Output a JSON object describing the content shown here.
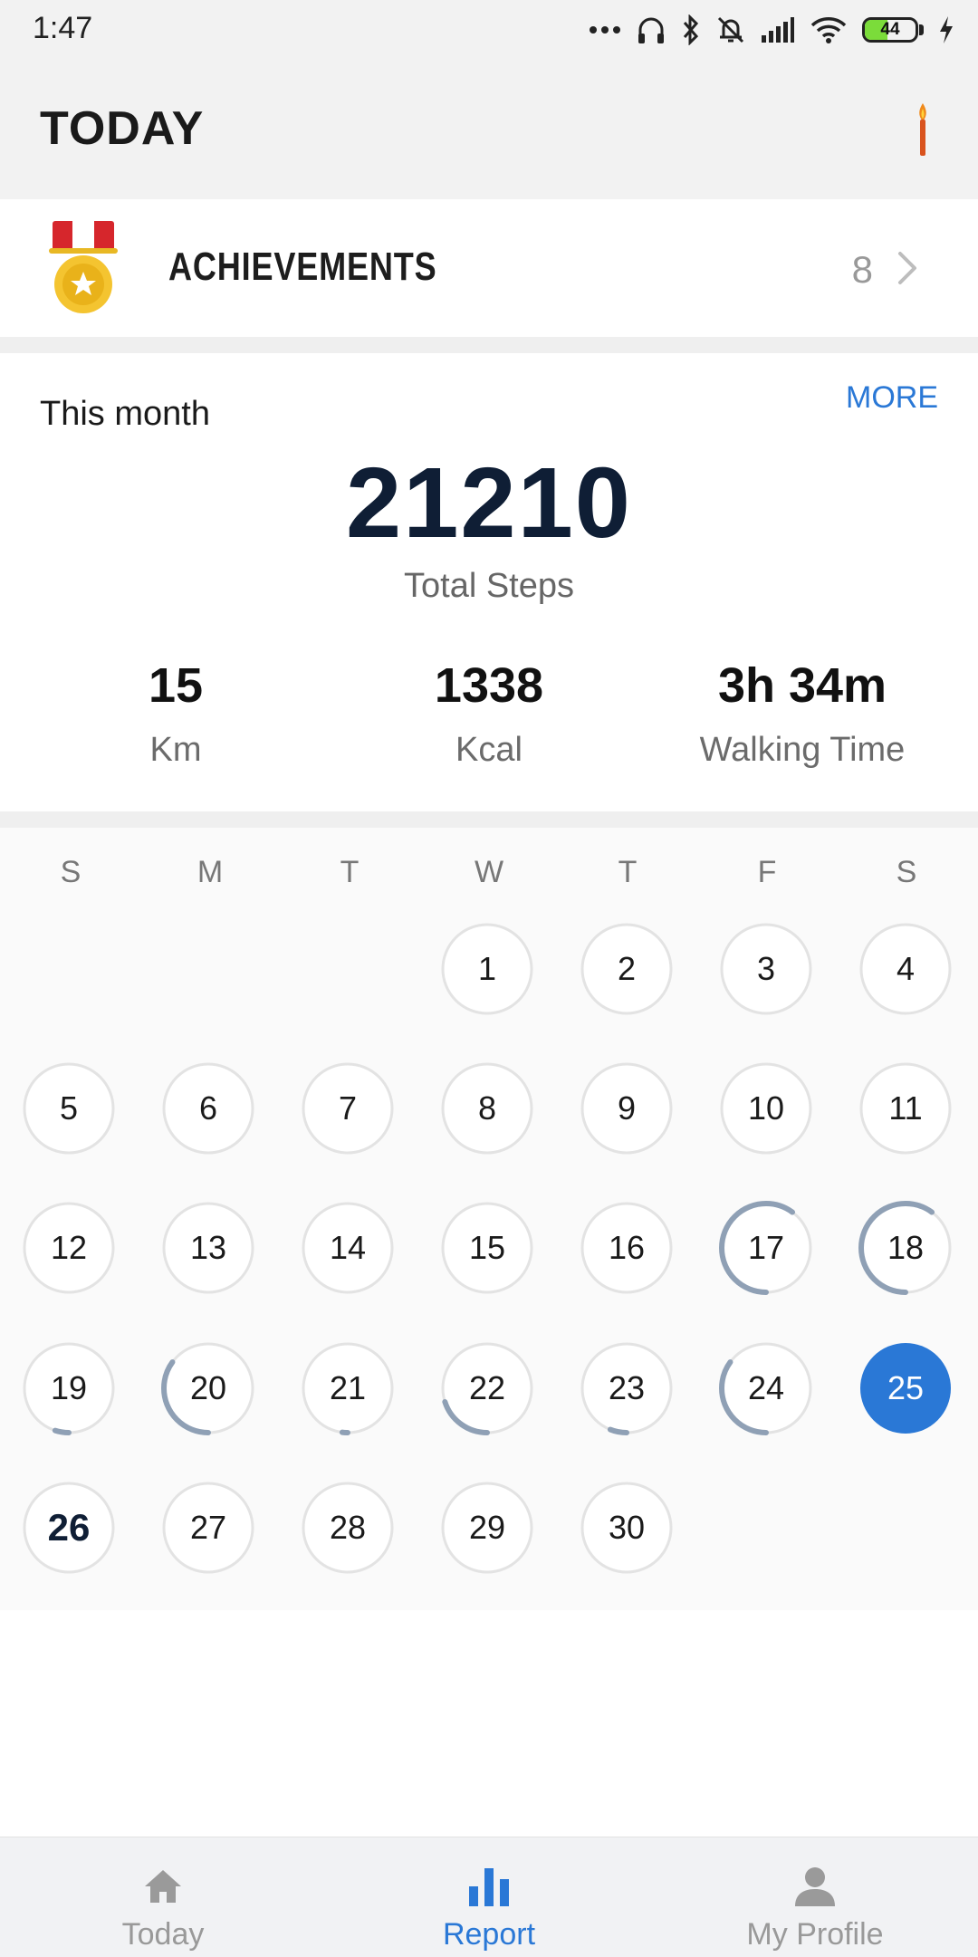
{
  "status_bar": {
    "time": "1:47",
    "battery": "44",
    "battery_level": 0.44,
    "icons": [
      "more-dots-icon",
      "headphones-icon",
      "bluetooth-icon",
      "mute-icon",
      "signal-icon",
      "wifi-icon",
      "battery-icon",
      "charging-icon"
    ]
  },
  "header": {
    "title": "TODAY",
    "icon": "torch-icon"
  },
  "achievements": {
    "label": "ACHIEVEMENTS",
    "count": "8"
  },
  "month_summary": {
    "label": "This month",
    "more": "MORE",
    "total_steps": "21210",
    "total_steps_label": "Total Steps",
    "stats": [
      {
        "value": "15",
        "label": "Km"
      },
      {
        "value": "1338",
        "label": "Kcal"
      },
      {
        "value": "3h 34m",
        "label": "Walking Time"
      }
    ]
  },
  "calendar": {
    "weekdays": [
      "S",
      "M",
      "T",
      "W",
      "T",
      "F",
      "S"
    ],
    "first_weekday_index": 3,
    "today": 26,
    "selected": 25,
    "days": [
      {
        "day": "1",
        "progress": 0
      },
      {
        "day": "2",
        "progress": 0
      },
      {
        "day": "3",
        "progress": 0
      },
      {
        "day": "4",
        "progress": 0
      },
      {
        "day": "5",
        "progress": 0
      },
      {
        "day": "6",
        "progress": 0
      },
      {
        "day": "7",
        "progress": 0
      },
      {
        "day": "8",
        "progress": 0
      },
      {
        "day": "9",
        "progress": 0
      },
      {
        "day": "10",
        "progress": 0
      },
      {
        "day": "11",
        "progress": 0
      },
      {
        "day": "12",
        "progress": 0
      },
      {
        "day": "13",
        "progress": 0
      },
      {
        "day": "14",
        "progress": 0
      },
      {
        "day": "15",
        "progress": 0
      },
      {
        "day": "16",
        "progress": 0
      },
      {
        "day": "17",
        "progress": 0.6
      },
      {
        "day": "18",
        "progress": 0.6
      },
      {
        "day": "19",
        "progress": 0.05
      },
      {
        "day": "20",
        "progress": 0.35
      },
      {
        "day": "21",
        "progress": 0.02
      },
      {
        "day": "22",
        "progress": 0.2
      },
      {
        "day": "23",
        "progress": 0.06
      },
      {
        "day": "24",
        "progress": 0.35
      },
      {
        "day": "25",
        "progress": 0
      },
      {
        "day": "26",
        "progress": 0
      },
      {
        "day": "27",
        "progress": 0
      },
      {
        "day": "28",
        "progress": 0
      },
      {
        "day": "29",
        "progress": 0
      },
      {
        "day": "30",
        "progress": 0
      }
    ]
  },
  "bottom_nav": {
    "items": [
      {
        "label": "Today",
        "icon": "home-icon"
      },
      {
        "label": "Report",
        "icon": "bar-chart-icon"
      },
      {
        "label": "My Profile",
        "icon": "person-icon"
      }
    ],
    "active_index": 1
  },
  "colors": {
    "accent": "#2a78d6",
    "ring": "#8fa0b5",
    "ring_track": "#e3e3e3",
    "steps_text": "#0f1e35"
  }
}
